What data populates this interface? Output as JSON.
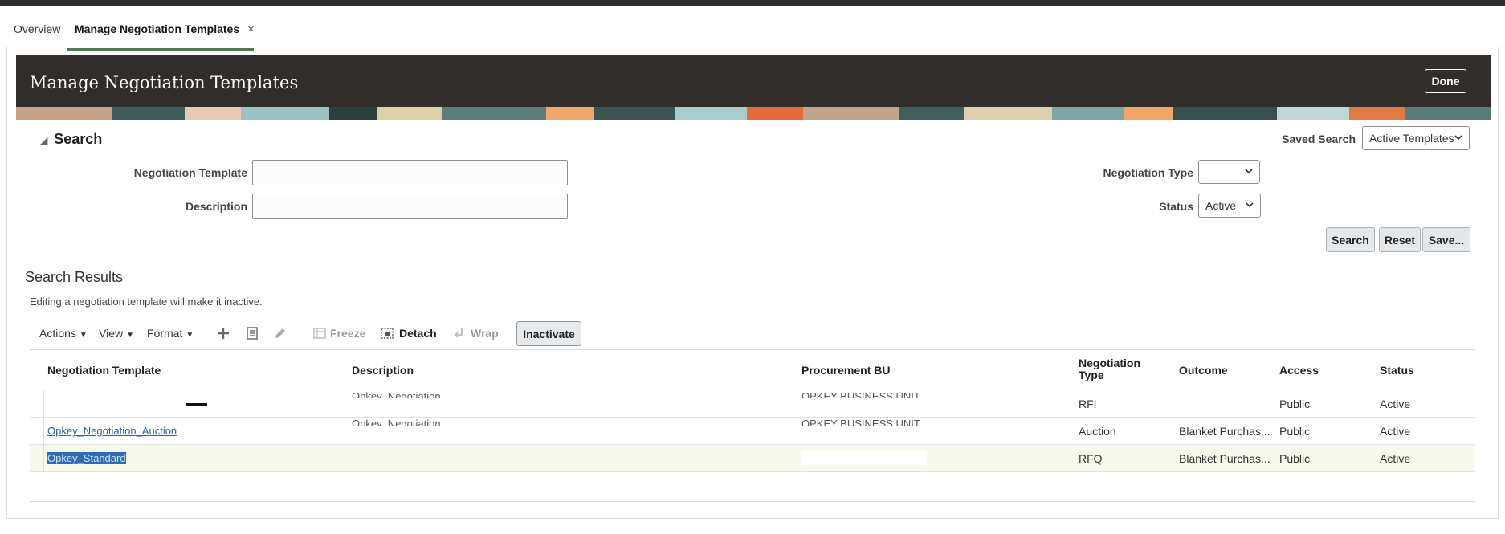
{
  "tabs": {
    "overview": "Overview",
    "active": "Manage Negotiation Templates",
    "close": "×"
  },
  "header": {
    "title": "Manage Negotiation Templates",
    "done": "Done"
  },
  "search": {
    "heading": "Search",
    "saved_search_label": "Saved Search",
    "saved_search_value": "Active Templates",
    "negotiation_template_label": "Negotiation Template",
    "description_label": "Description",
    "negotiation_type_label": "Negotiation Type",
    "negotiation_type_value": "",
    "status_label": "Status",
    "status_value": "Active",
    "buttons": {
      "search": "Search",
      "reset": "Reset",
      "save": "Save..."
    }
  },
  "results": {
    "title": "Search Results",
    "info": "Editing a negotiation template will make it inactive.",
    "toolbar": {
      "actions": "Actions",
      "view": "View",
      "format": "Format",
      "freeze": "Freeze",
      "detach": "Detach",
      "wrap": "Wrap",
      "inactivate": "Inactivate"
    },
    "columns": [
      "Negotiation Template",
      "Description",
      "Procurement BU",
      "Negotiation Type",
      "Outcome",
      "Access",
      "Status"
    ],
    "rows": [
      {
        "template": "",
        "description": "Opkey_Negotiation",
        "bu": "OPKEY BUSINESS UNIT",
        "type": "RFI",
        "outcome": "",
        "access": "Public",
        "status": "Active"
      },
      {
        "template": "Opkey_Negotiation_Auction",
        "description": "Opkey_Negotiation",
        "bu": "OPKEY BUSINESS UNIT",
        "type": "Auction",
        "outcome": "Blanket Purchas...",
        "access": "Public",
        "status": "Active"
      },
      {
        "template": "Opkey_Standard",
        "description": "",
        "bu": "",
        "type": "RFQ",
        "outcome": "Blanket Purchas...",
        "access": "Public",
        "status": "Active"
      }
    ]
  },
  "colors": {
    "header_bg": "#312d2a",
    "tab_underline": "#4f7d4f",
    "link": "#2664a8",
    "selected_row": "#f7f9ec"
  }
}
